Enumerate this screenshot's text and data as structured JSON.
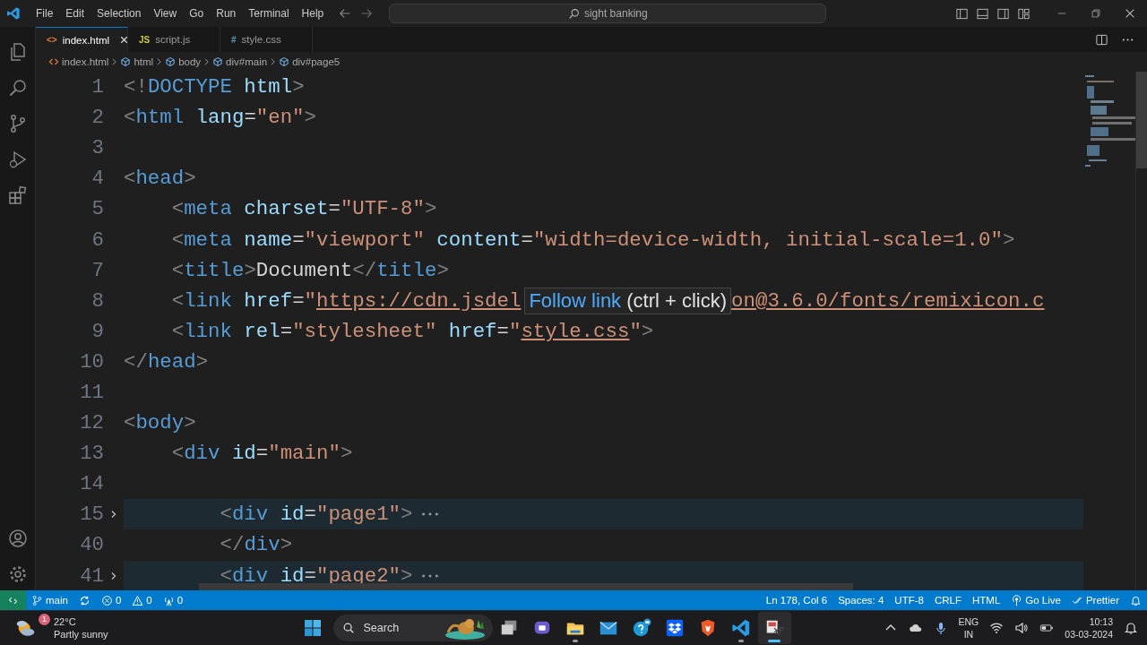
{
  "title_bar": {
    "menu": [
      "File",
      "Edit",
      "Selection",
      "View",
      "Go",
      "Run",
      "Terminal",
      "Help"
    ],
    "search": {
      "value": "sight banking"
    }
  },
  "tabs": [
    {
      "label": "index.html",
      "glyph": "<>",
      "kind": "html",
      "selected": true
    },
    {
      "label": "script.js",
      "glyph": "JS",
      "kind": "js",
      "selected": false
    },
    {
      "label": "style.css",
      "glyph": "#",
      "kind": "css",
      "selected": false
    }
  ],
  "breadcrumbs": [
    {
      "label": "index.html",
      "kind": "file"
    },
    {
      "label": "html",
      "kind": "element"
    },
    {
      "label": "body",
      "kind": "element"
    },
    {
      "label": "div#main",
      "kind": "element"
    },
    {
      "label": "div#page5",
      "kind": "element"
    }
  ],
  "editor": {
    "lines": [
      {
        "number": "1",
        "collapsed": false,
        "tokens": [
          {
            "kind": "punct",
            "text": "<!"
          },
          {
            "kind": "tag",
            "text": "DOCTYPE"
          },
          {
            "kind": "attr",
            "text": " html"
          },
          {
            "kind": "punct",
            "text": ">"
          }
        ]
      },
      {
        "number": "2",
        "collapsed": false,
        "tokens": [
          {
            "kind": "punct",
            "text": "<"
          },
          {
            "kind": "tag",
            "text": "html"
          },
          {
            "kind": "attr",
            "text": " lang"
          },
          {
            "kind": "text",
            "text": "="
          },
          {
            "kind": "string",
            "text": "\"en\""
          },
          {
            "kind": "punct",
            "text": ">"
          }
        ]
      },
      {
        "number": "3",
        "collapsed": false
      },
      {
        "number": "4",
        "collapsed": false,
        "tokens": [
          {
            "kind": "punct",
            "text": "<"
          },
          {
            "kind": "tag",
            "text": "head"
          },
          {
            "kind": "punct",
            "text": ">"
          }
        ]
      },
      {
        "number": "5",
        "collapsed": false,
        "tokens": [
          {
            "kind": "punct",
            "text": "    <"
          },
          {
            "kind": "tag",
            "text": "meta"
          },
          {
            "kind": "attr",
            "text": " charset"
          },
          {
            "kind": "text",
            "text": "="
          },
          {
            "kind": "string",
            "text": "\"UTF-8\""
          },
          {
            "kind": "punct",
            "text": ">"
          }
        ]
      },
      {
        "number": "6",
        "collapsed": false,
        "tokens": [
          {
            "kind": "punct",
            "text": "    <"
          },
          {
            "kind": "tag",
            "text": "meta"
          },
          {
            "kind": "attr",
            "text": " name"
          },
          {
            "kind": "text",
            "text": "="
          },
          {
            "kind": "string",
            "text": "\"viewport\""
          },
          {
            "kind": "attr",
            "text": " content"
          },
          {
            "kind": "text",
            "text": "="
          },
          {
            "kind": "string",
            "text": "\"width=device-width, initial-scale=1.0\""
          },
          {
            "kind": "punct",
            "text": ">"
          }
        ]
      },
      {
        "number": "7",
        "collapsed": false,
        "tokens": [
          {
            "kind": "punct",
            "text": "    <"
          },
          {
            "kind": "tag",
            "text": "title"
          },
          {
            "kind": "punct",
            "text": ">"
          },
          {
            "kind": "text",
            "text": "Document"
          },
          {
            "kind": "punct",
            "text": "</"
          },
          {
            "kind": "tag",
            "text": "title"
          },
          {
            "kind": "punct",
            "text": ">"
          }
        ]
      },
      {
        "number": "8",
        "collapsed": false,
        "tokens": [
          {
            "kind": "punct",
            "text": "    <"
          },
          {
            "kind": "tag",
            "text": "link"
          },
          {
            "kind": "attr",
            "text": " href"
          },
          {
            "kind": "text",
            "text": "="
          },
          {
            "kind": "string",
            "text": "\""
          },
          {
            "kind": "link",
            "text": "https://cdn.jsdel"
          }
        ],
        "hover": {
          "link": "Follow link",
          "hint": "(ctrl + click)"
        },
        "tokens_after": [
          {
            "kind": "link",
            "text": "on@3.6.0/fonts/remixicon.c"
          }
        ]
      },
      {
        "number": "9",
        "collapsed": false,
        "tokens": [
          {
            "kind": "punct",
            "text": "    <"
          },
          {
            "kind": "tag",
            "text": "link"
          },
          {
            "kind": "attr",
            "text": " rel"
          },
          {
            "kind": "text",
            "text": "="
          },
          {
            "kind": "string",
            "text": "\"stylesheet\""
          },
          {
            "kind": "attr",
            "text": " href"
          },
          {
            "kind": "text",
            "text": "="
          },
          {
            "kind": "string",
            "text": "\""
          },
          {
            "kind": "link",
            "text": "style.css"
          },
          {
            "kind": "string",
            "text": "\""
          },
          {
            "kind": "punct",
            "text": ">"
          }
        ]
      },
      {
        "number": "10",
        "collapsed": false,
        "tokens": [
          {
            "kind": "punct",
            "text": "</"
          },
          {
            "kind": "tag",
            "text": "head"
          },
          {
            "kind": "punct",
            "text": ">"
          }
        ]
      },
      {
        "number": "11",
        "collapsed": false
      },
      {
        "number": "12",
        "collapsed": false,
        "tokens": [
          {
            "kind": "punct",
            "text": "<"
          },
          {
            "kind": "tag",
            "text": "body"
          },
          {
            "kind": "punct",
            "text": ">"
          }
        ]
      },
      {
        "number": "13",
        "collapsed": false,
        "tokens": [
          {
            "kind": "punct",
            "text": "    <"
          },
          {
            "kind": "tag",
            "text": "div"
          },
          {
            "kind": "attr",
            "text": " id"
          },
          {
            "kind": "text",
            "text": "="
          },
          {
            "kind": "string",
            "text": "\"main\""
          },
          {
            "kind": "punct",
            "text": ">"
          }
        ]
      },
      {
        "number": "14",
        "collapsed": false
      },
      {
        "number": "15",
        "collapsed": true,
        "tokens": [
          {
            "kind": "punct",
            "text": "        <"
          },
          {
            "kind": "tag",
            "text": "div"
          },
          {
            "kind": "attr",
            "text": " id"
          },
          {
            "kind": "text",
            "text": "="
          },
          {
            "kind": "string",
            "text": "\"page1\""
          },
          {
            "kind": "punct",
            "text": ">"
          }
        ]
      },
      {
        "number": "40",
        "collapsed": false,
        "tokens": [
          {
            "kind": "punct",
            "text": "        </"
          },
          {
            "kind": "tag",
            "text": "div"
          },
          {
            "kind": "punct",
            "text": ">"
          }
        ]
      },
      {
        "number": "41",
        "collapsed": true,
        "tokens": [
          {
            "kind": "punct",
            "text": "        <"
          },
          {
            "kind": "tag",
            "text": "div"
          },
          {
            "kind": "attr",
            "text": " id"
          },
          {
            "kind": "text",
            "text": "="
          },
          {
            "kind": "string",
            "text": "\"page2\""
          },
          {
            "kind": "punct",
            "text": ">"
          }
        ]
      }
    ]
  },
  "status_bar": {
    "left": [
      {
        "kind": "remote"
      },
      {
        "kind": "branch",
        "label": "main"
      },
      {
        "kind": "sync"
      },
      {
        "kind": "errors",
        "label": "0"
      },
      {
        "kind": "warnings",
        "label": "0"
      },
      {
        "kind": "ports",
        "label": "0"
      }
    ],
    "right": [
      {
        "kind": "text",
        "label": "Ln 178, Col 6"
      },
      {
        "kind": "text",
        "label": "Spaces: 4"
      },
      {
        "kind": "text",
        "label": "UTF-8"
      },
      {
        "kind": "text",
        "label": "CRLF"
      },
      {
        "kind": "text",
        "label": "HTML"
      },
      {
        "kind": "golive",
        "label": "Go Live"
      },
      {
        "kind": "prettier",
        "label": "Prettier"
      },
      {
        "kind": "bell"
      }
    ]
  },
  "taskbar": {
    "weather": {
      "temperature": "22°C",
      "condition": "Partly sunny",
      "badge": "1"
    },
    "search": {
      "placeholder": "Search"
    },
    "apps": [
      {
        "kind": "taskview",
        "running": false,
        "selected": false
      },
      {
        "kind": "chat",
        "running": false,
        "selected": false
      },
      {
        "kind": "files",
        "running": true,
        "selected": false
      },
      {
        "kind": "mail",
        "running": false,
        "selected": false
      },
      {
        "kind": "help",
        "running": false,
        "selected": false
      },
      {
        "kind": "dropbox",
        "running": false,
        "selected": false
      },
      {
        "kind": "brave",
        "running": false,
        "selected": false
      },
      {
        "kind": "vscode",
        "running": true,
        "selected": false
      },
      {
        "kind": "snip",
        "running": true,
        "selected": true
      }
    ],
    "tray": {
      "language": "ENG",
      "region": "IN",
      "time": "10:13",
      "date": "03-03-2024"
    }
  }
}
